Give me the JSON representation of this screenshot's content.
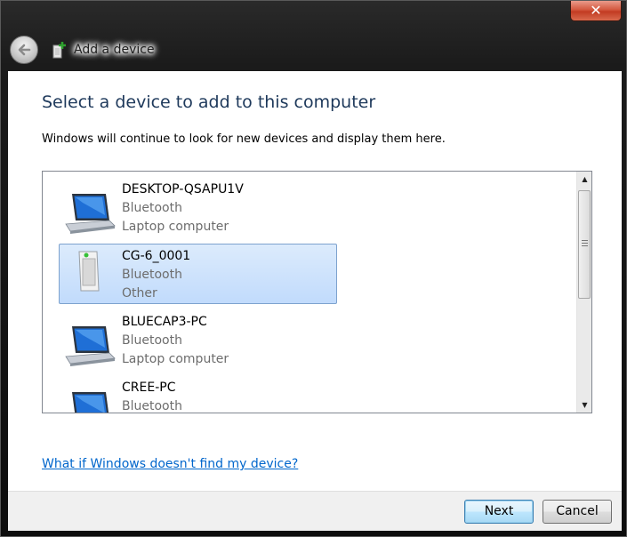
{
  "window": {
    "title": "Add a device",
    "close_symbol": "✕"
  },
  "page": {
    "heading": "Select a device to add to this computer",
    "description": "Windows will continue to look for new devices and display them here."
  },
  "devices": [
    {
      "name": "DESKTOP-QSAPU1V",
      "connection": "Bluetooth",
      "kind": "Laptop computer",
      "icon": "laptop-icon",
      "selected": false
    },
    {
      "name": "CG-6_0001",
      "connection": "Bluetooth",
      "kind": "Other",
      "icon": "generic-device-icon",
      "selected": true
    },
    {
      "name": "BLUECAP3-PC",
      "connection": "Bluetooth",
      "kind": "Laptop computer",
      "icon": "laptop-icon",
      "selected": false
    },
    {
      "name": "CREE-PC",
      "connection": "Bluetooth",
      "kind": "",
      "icon": "laptop-icon",
      "selected": false
    }
  ],
  "help_link": "What if Windows doesn't find my device?",
  "buttons": {
    "next": "Next",
    "cancel": "Cancel"
  },
  "colors": {
    "heading": "#1e395b",
    "link": "#0066cc",
    "selection": "#c1dbfc",
    "close_button": "#c23b22"
  }
}
